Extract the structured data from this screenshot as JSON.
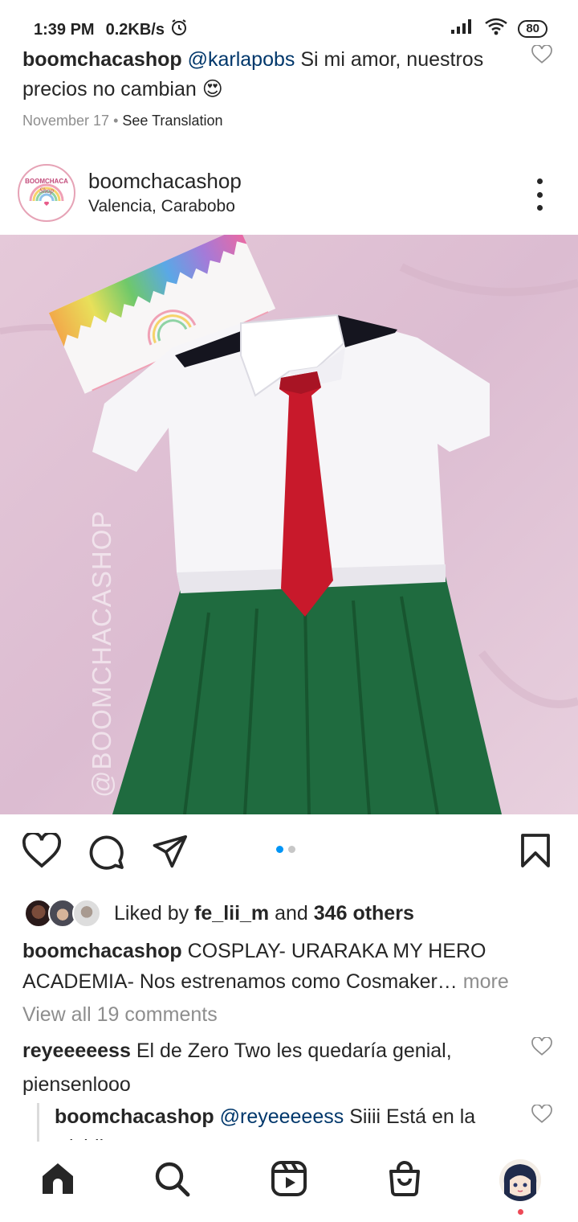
{
  "status_bar": {
    "time": "1:39 PM",
    "speed": "0.2KB/s",
    "battery": "80"
  },
  "top_comment": {
    "username": "boomchacashop",
    "mention": "@karlapobs",
    "text": " Si mi amor, nuestros precios no cambian ",
    "emoji": "😍",
    "date": "November 17",
    "separator": "•",
    "see_translation": "See Translation"
  },
  "post": {
    "username": "boomchacashop",
    "location": "Valencia, Carabobo",
    "watermark": "@BOOMCHACASHOP",
    "logo_text": "BOOMCHACA",
    "logo_sub": "Shop",
    "carousel_dots": 2,
    "active_dot": 0
  },
  "likes": {
    "prefix": "Liked by ",
    "user": "fe_lii_m",
    "middle": " and ",
    "count": "346 others"
  },
  "caption": {
    "username": "boomchacashop",
    "text": " COSPLAY- URARAKA MY HERO ACADEMIA- Nos estrenamos como Cosmaker…",
    "more": " more"
  },
  "view_all_comments": "View all 19 comments",
  "comments": [
    {
      "username": "reyeeeeess",
      "text": " El de Zero Two les quedaría genial, piensenlooo"
    }
  ],
  "reply": {
    "username": "boomchacashop",
    "mention": "@reyeeeeess",
    "text": " Siiii Está en la wishlist"
  },
  "colors": {
    "link": "#00376b",
    "secondary": "#8e8e8e",
    "active_dot": "#0095f6",
    "notification": "#ed4956"
  },
  "nav": [
    "home-icon",
    "search-icon",
    "reels-icon",
    "shop-icon",
    "profile-avatar"
  ]
}
